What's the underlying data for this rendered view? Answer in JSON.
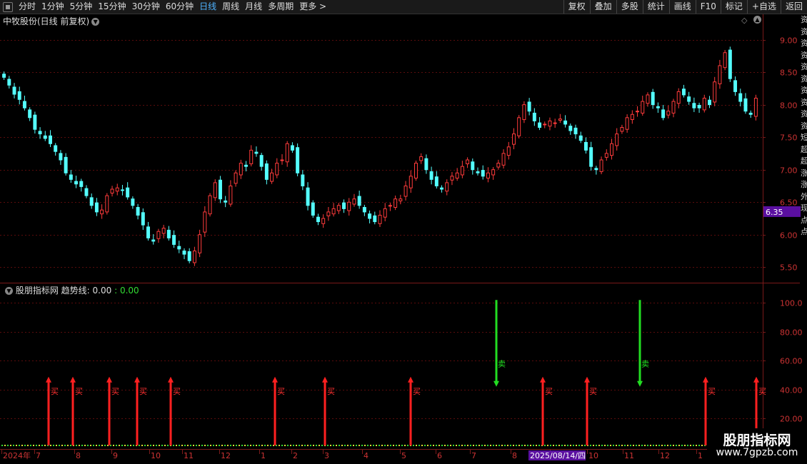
{
  "toolbar": {
    "tabs": [
      "分时",
      "1分钟",
      "5分钟",
      "15分钟",
      "30分钟",
      "60分钟",
      "日线",
      "周线",
      "月线",
      "多周期",
      "更多 >"
    ],
    "active_index": 6,
    "right_buttons": [
      "复权",
      "叠加",
      "多股",
      "统计",
      "画线",
      "F10",
      "标记",
      "+自选",
      "返回"
    ]
  },
  "stock_title": "中牧股份(日线 前复权)",
  "main_chart": {
    "price_ticks": [
      "9.00",
      "8.50",
      "8.00",
      "7.50",
      "7.00",
      "6.50",
      "6.00",
      "5.50"
    ],
    "price_values": [
      9.0,
      8.5,
      8.0,
      7.5,
      7.0,
      6.5,
      6.0,
      5.5
    ],
    "current_price_label": "6.35",
    "current_price": 6.35,
    "ylim": [
      5.35,
      9.28
    ]
  },
  "indicator": {
    "name": "股朋指标网",
    "trend_label": "趋势线:",
    "value1": "0.00",
    "value2": "0.00",
    "ticks": [
      "100.0",
      "80.00",
      "60.00",
      "40.00",
      "20.00"
    ],
    "tick_values": [
      100,
      80,
      60,
      40,
      20
    ],
    "buy_label": "买",
    "sell_label": "卖"
  },
  "x_axis": {
    "labels": [
      "2024年",
      "7",
      "8",
      "9",
      "10",
      "11",
      "12",
      "1",
      "2",
      "3",
      "4",
      "5",
      "6",
      "7",
      "8",
      "9",
      "10",
      "11",
      "12",
      "1"
    ],
    "highlight_label": "2025/08/14/四"
  },
  "watermark": {
    "line1": "股朋指标网",
    "line2": "www.7gpzb.com"
  },
  "right_strip_text": "资资资资资资资资资资短超超涨涨外现点点",
  "chart_data": {
    "type": "candlestick",
    "title": "中牧股份(日线 前复权)",
    "price_ticks": [
      9.0,
      8.5,
      8.0,
      7.5,
      7.0,
      6.5,
      6.0,
      5.5
    ],
    "closes": [
      8.42,
      8.3,
      8.16,
      8.08,
      7.95,
      7.8,
      7.62,
      7.55,
      7.48,
      7.4,
      7.28,
      7.15,
      6.95,
      6.85,
      6.78,
      6.74,
      6.6,
      6.45,
      6.35,
      6.38,
      6.6,
      6.7,
      6.72,
      6.68,
      6.58,
      6.45,
      6.3,
      6.15,
      5.95,
      5.9,
      6.05,
      6.1,
      5.95,
      5.85,
      5.78,
      5.7,
      5.6,
      5.75,
      6.0,
      6.35,
      6.6,
      6.8,
      6.55,
      6.5,
      6.75,
      6.95,
      7.1,
      7.05,
      7.3,
      7.25,
      7.05,
      6.85,
      6.95,
      7.1,
      7.15,
      7.4,
      7.3,
      6.95,
      6.75,
      6.45,
      6.3,
      6.2,
      6.25,
      6.35,
      6.4,
      6.45,
      6.4,
      6.5,
      6.55,
      6.45,
      6.35,
      6.25,
      6.2,
      6.3,
      6.4,
      6.45,
      6.55,
      6.55,
      6.75,
      6.9,
      7.1,
      7.2,
      7.0,
      6.85,
      6.75,
      6.7,
      6.8,
      6.9,
      6.95,
      7.05,
      7.15,
      7.0,
      6.95,
      6.9,
      6.95,
      7.0,
      7.1,
      7.25,
      7.35,
      7.55,
      7.8,
      8.0,
      7.9,
      7.75,
      7.65,
      7.7,
      7.75,
      7.72,
      7.78,
      7.7,
      7.6,
      7.55,
      7.45,
      7.3,
      7.05,
      7.0,
      7.15,
      7.25,
      7.4,
      7.55,
      7.65,
      7.8,
      7.85,
      7.9,
      8.05,
      8.15,
      8.0,
      7.95,
      7.8,
      7.9,
      8.05,
      8.2,
      8.15,
      8.05,
      7.95,
      7.95,
      8.1,
      8.0,
      8.35,
      8.6,
      8.8,
      8.4,
      8.2,
      8.05,
      7.9,
      7.85,
      8.1
    ],
    "buy_signal_x": [
      68,
      102,
      153,
      192,
      239,
      385,
      455,
      575,
      760,
      822,
      988,
      1059
    ],
    "sell_signal_x": [
      695,
      896
    ]
  }
}
